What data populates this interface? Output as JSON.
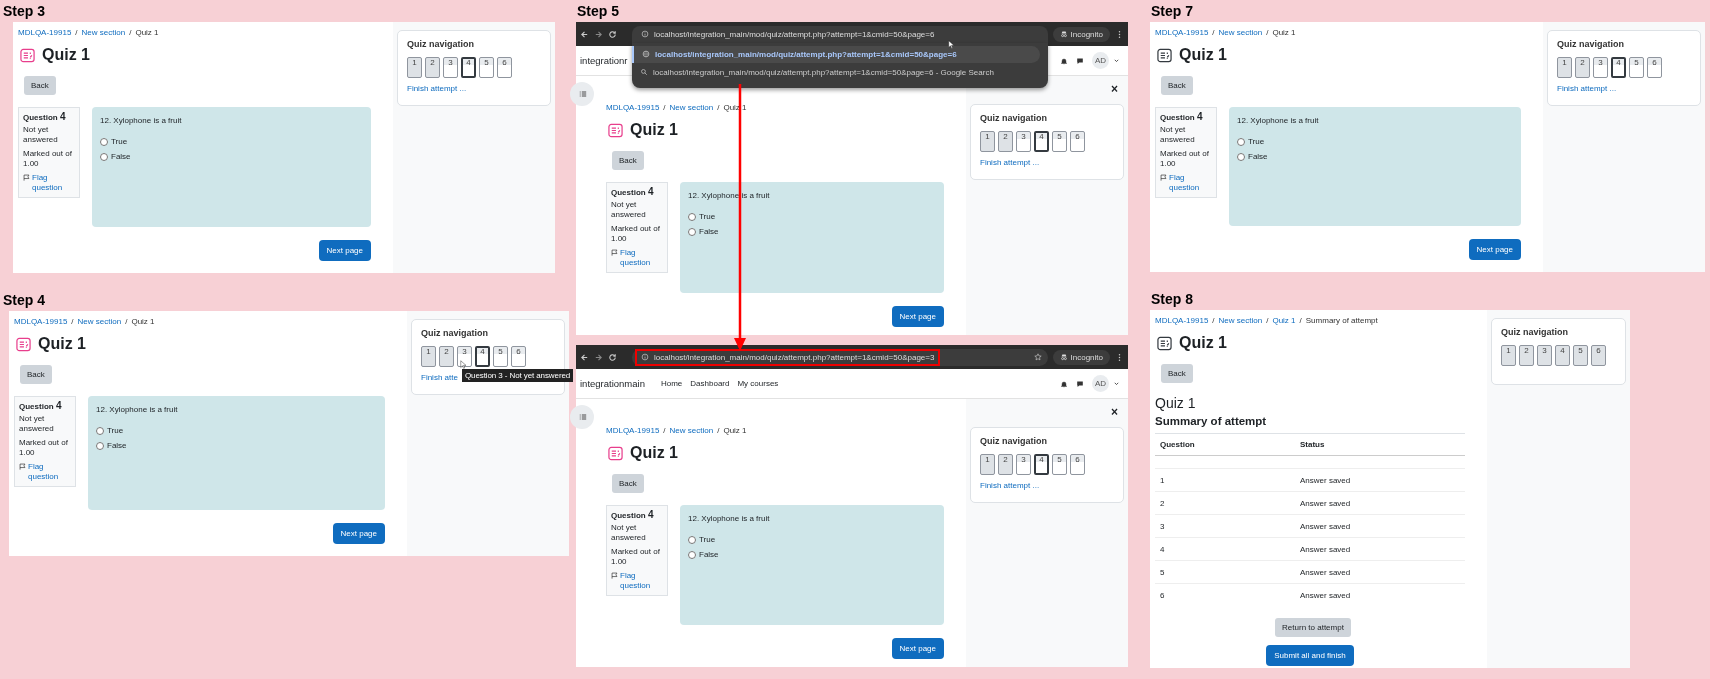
{
  "columns": [
    {
      "steps": [
        {
          "label": "Step 3",
          "screens": [
            {
              "kind": "quiz",
              "breadcrumb": [
                {
                  "text": "MDLQA-19915",
                  "kind": "link"
                },
                {
                  "text": "/",
                  "kind": "separator"
                },
                {
                  "text": "New section",
                  "kind": "link"
                },
                {
                  "text": "/",
                  "kind": "separator"
                },
                {
                  "text": "Quiz 1",
                  "kind": "current"
                }
              ],
              "title": "Quiz 1",
              "color": "#e83e8c",
              "back": "Back",
              "question": {
                "label": "Question",
                "number": "4",
                "state": "Not yet answered",
                "marks": "Marked out of 1.00",
                "flag": "Flag question",
                "text": "12. Xylophone is a fruit",
                "options": [
                  {
                    "label": "True",
                    "selected": false
                  },
                  {
                    "label": "False",
                    "selected": false
                  }
                ]
              },
              "next": "Next page",
              "nav": {
                "title": "Quiz navigation",
                "buttons": [
                  {
                    "label": "1",
                    "answered": true,
                    "current": false
                  },
                  {
                    "label": "2",
                    "answered": true,
                    "current": false
                  },
                  {
                    "label": "3",
                    "answered": false,
                    "current": false
                  },
                  {
                    "label": "4",
                    "answered": false,
                    "current": true
                  },
                  {
                    "label": "5",
                    "answered": false,
                    "current": false
                  },
                  {
                    "label": "6",
                    "answered": false,
                    "current": false
                  }
                ],
                "finish": "Finish attempt ..."
              }
            }
          ]
        },
        {
          "label": "Step 4",
          "screens": [
            {
              "kind": "quiz",
              "breadcrumb": [
                {
                  "text": "MDLQA-19915",
                  "kind": "link"
                },
                {
                  "text": "/",
                  "kind": "separator"
                },
                {
                  "text": "New section",
                  "kind": "link"
                },
                {
                  "text": "/",
                  "kind": "separator"
                },
                {
                  "text": "Quiz 1",
                  "kind": "current"
                }
              ],
              "title": "Quiz 1",
              "color": "#e83e8c",
              "back": "Back",
              "question": {
                "label": "Question",
                "number": "4",
                "state": "Not yet answered",
                "marks": "Marked out of 1.00",
                "flag": "Flag question",
                "text": "12. Xylophone is a fruit",
                "options": [
                  {
                    "label": "True",
                    "selected": false
                  },
                  {
                    "label": "False",
                    "selected": false
                  }
                ]
              },
              "next": "Next page",
              "nav": {
                "title": "Quiz navigation",
                "buttons": [
                  {
                    "label": "1",
                    "answered": true,
                    "current": false
                  },
                  {
                    "label": "2",
                    "answered": true,
                    "current": false
                  },
                  {
                    "label": "3",
                    "answered": false,
                    "current": false,
                    "tooltip": "Question 3 - Not yet answered"
                  },
                  {
                    "label": "4",
                    "answered": false,
                    "current": true
                  },
                  {
                    "label": "5",
                    "answered": false,
                    "current": false
                  },
                  {
                    "label": "6",
                    "answered": false,
                    "current": false
                  }
                ],
                "finish": "Finish atte"
              }
            }
          ]
        }
      ]
    },
    {
      "steps": [
        {
          "label": "Step 5",
          "screens": [
            {
              "kind": "quiz",
              "browser": {
                "address": "localhost/integration_main/mod/quiz/attempt.php?attempt=1&cmid=50&page=6",
                "highlighted": false,
                "suggestions": [
                  {
                    "text": "localhost/integration_main/mod/quiz/attempt.php?attempt=1&cmid=50&page=6",
                    "kind": "url",
                    "selected": true
                  },
                  {
                    "text": "localhost/integration_main/mod/quiz/attempt.php?attempt=1&cmid=50&page=6 - Google Search",
                    "kind": "search",
                    "selected": false
                  }
                ],
                "incognito": "Incognito",
                "site_name": "integrationr",
                "avatar": "AD",
                "close": "×"
              },
              "breadcrumb": [
                {
                  "text": "MDLQA-19915",
                  "kind": "link"
                },
                {
                  "text": "/",
                  "kind": "separator"
                },
                {
                  "text": "New section",
                  "kind": "link"
                },
                {
                  "text": "/",
                  "kind": "separator"
                },
                {
                  "text": "Quiz 1",
                  "kind": "current"
                }
              ],
              "title": "Quiz 1",
              "color": "#e83e8c",
              "back": "Back",
              "question": {
                "label": "Question",
                "number": "4",
                "state": "Not yet answered",
                "marks": "Marked out of 1.00",
                "flag": "Flag question",
                "text": "12. Xylophone is a fruit",
                "options": [
                  {
                    "label": "True",
                    "selected": false
                  },
                  {
                    "label": "False",
                    "selected": false
                  }
                ]
              },
              "next": "Next page",
              "nav": {
                "title": "Quiz navigation",
                "buttons": [
                  {
                    "label": "1",
                    "answered": true,
                    "current": false
                  },
                  {
                    "label": "2",
                    "answered": true,
                    "current": false
                  },
                  {
                    "label": "3",
                    "answered": false,
                    "current": false
                  },
                  {
                    "label": "4",
                    "answered": false,
                    "current": true
                  },
                  {
                    "label": "5",
                    "answered": false,
                    "current": false
                  },
                  {
                    "label": "6",
                    "answered": false,
                    "current": false
                  }
                ],
                "finish": "Finish attempt ..."
              }
            },
            {
              "kind": "quiz",
              "browser": {
                "address": "localhost/integration_main/mod/quiz/attempt.php?attempt=1&cmid=50&page=3",
                "highlighted": true,
                "incognito": "Incognito",
                "site_name": "integrationmain",
                "nav_links": [
                  "Home",
                  "Dashboard",
                  "My courses"
                ],
                "avatar": "AD",
                "close": "×"
              },
              "breadcrumb": [
                {
                  "text": "MDLQA-19915",
                  "kind": "link"
                },
                {
                  "text": "/",
                  "kind": "separator"
                },
                {
                  "text": "New section",
                  "kind": "link"
                },
                {
                  "text": "/",
                  "kind": "separator"
                },
                {
                  "text": "Quiz 1",
                  "kind": "current"
                }
              ],
              "title": "Quiz 1",
              "color": "#e83e8c",
              "back": "Back",
              "question": {
                "label": "Question",
                "number": "4",
                "state": "Not yet answered",
                "marks": "Marked out of 1.00",
                "flag": "Flag question",
                "text": "12. Xylophone is a fruit",
                "options": [
                  {
                    "label": "True",
                    "selected": false
                  },
                  {
                    "label": "False",
                    "selected": false
                  }
                ]
              },
              "next": "Next page",
              "nav": {
                "title": "Quiz navigation",
                "buttons": [
                  {
                    "label": "1",
                    "answered": true,
                    "current": false
                  },
                  {
                    "label": "2",
                    "answered": true,
                    "current": false
                  },
                  {
                    "label": "3",
                    "answered": false,
                    "current": false
                  },
                  {
                    "label": "4",
                    "answered": false,
                    "current": true
                  },
                  {
                    "label": "5",
                    "answered": false,
                    "current": false
                  },
                  {
                    "label": "6",
                    "answered": false,
                    "current": false
                  }
                ],
                "finish": "Finish attempt ..."
              }
            }
          ]
        }
      ]
    },
    {
      "steps": [
        {
          "label": "Step 7",
          "screens": [
            {
              "kind": "quiz",
              "breadcrumb": [
                {
                  "text": "MDLQA-19915",
                  "kind": "link"
                },
                {
                  "text": "/",
                  "kind": "separator"
                },
                {
                  "text": "New section",
                  "kind": "link"
                },
                {
                  "text": "/",
                  "kind": "separator"
                },
                {
                  "text": "Quiz 1",
                  "kind": "current"
                }
              ],
              "title": "Quiz 1",
              "color": "#343a40",
              "back": "Back",
              "question": {
                "label": "Question",
                "number": "4",
                "state": "Not yet answered",
                "marks": "Marked out of 1.00",
                "flag": "Flag question",
                "text": "12. Xylophone is a fruit",
                "options": [
                  {
                    "label": "True",
                    "selected": false
                  },
                  {
                    "label": "False",
                    "selected": false
                  }
                ]
              },
              "next": "Next page",
              "nav": {
                "title": "Quiz navigation",
                "buttons": [
                  {
                    "label": "1",
                    "answered": true,
                    "current": false
                  },
                  {
                    "label": "2",
                    "answered": true,
                    "current": false
                  },
                  {
                    "label": "3",
                    "answered": false,
                    "current": false
                  },
                  {
                    "label": "4",
                    "answered": false,
                    "current": true
                  },
                  {
                    "label": "5",
                    "answered": false,
                    "current": false
                  },
                  {
                    "label": "6",
                    "answered": false,
                    "current": false
                  }
                ],
                "finish": "Finish attempt ..."
              }
            }
          ]
        },
        {
          "label": "Step 8",
          "screens": [
            {
              "kind": "summary",
              "breadcrumb": [
                {
                  "text": "MDLQA-19915",
                  "kind": "link"
                },
                {
                  "text": "/",
                  "kind": "separator"
                },
                {
                  "text": "New section",
                  "kind": "link"
                },
                {
                  "text": "/",
                  "kind": "separator"
                },
                {
                  "text": "Quiz 1",
                  "kind": "link"
                },
                {
                  "text": "/",
                  "kind": "separator"
                },
                {
                  "text": "Summary of attempt",
                  "kind": "current"
                }
              ],
              "title": "Quiz 1",
              "color": "#343a40",
              "back": "Back",
              "heading": "Quiz 1",
              "subheading": "Summary of attempt",
              "table": {
                "columns": [
                  "Question",
                  "Status"
                ],
                "rows": [
                  {
                    "question": "1",
                    "status": "Answer saved"
                  },
                  {
                    "question": "2",
                    "status": "Answer saved"
                  },
                  {
                    "question": "3",
                    "status": "Answer saved"
                  },
                  {
                    "question": "4",
                    "status": "Answer saved"
                  },
                  {
                    "question": "5",
                    "status": "Answer saved"
                  },
                  {
                    "question": "6",
                    "status": "Answer saved"
                  }
                ]
              },
              "return_button": "Return to attempt",
              "submit_button": "Submit all and finish",
              "nav": {
                "title": "Quiz navigation",
                "buttons": [
                  {
                    "label": "1",
                    "answered": true,
                    "current": false
                  },
                  {
                    "label": "2",
                    "answered": true,
                    "current": false
                  },
                  {
                    "label": "3",
                    "answered": true,
                    "current": false
                  },
                  {
                    "label": "4",
                    "answered": true,
                    "current": false
                  },
                  {
                    "label": "5",
                    "answered": true,
                    "current": false
                  },
                  {
                    "label": "6",
                    "answered": true,
                    "current": false
                  }
                ]
              }
            }
          ]
        }
      ]
    }
  ]
}
